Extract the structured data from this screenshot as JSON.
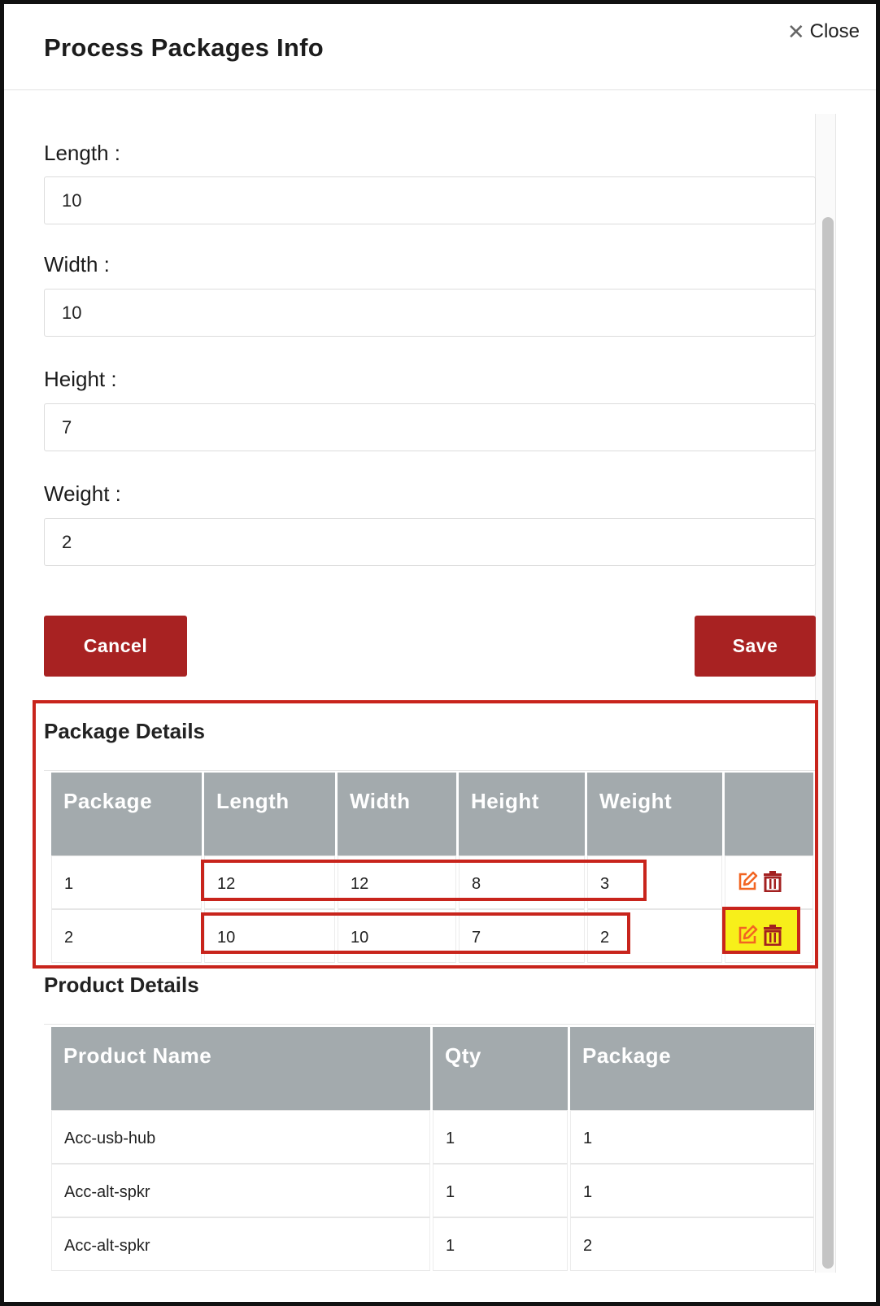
{
  "modal": {
    "title": "Process Packages Info",
    "close_label": "Close"
  },
  "form": {
    "length_label": "Length :",
    "length_value": "10",
    "width_label": "Width :",
    "width_value": "10",
    "height_label": "Height :",
    "height_value": "7",
    "weight_label": "Weight :",
    "weight_value": "2",
    "cancel_label": "Cancel",
    "save_label": "Save"
  },
  "package_details": {
    "title": "Package Details",
    "headers": [
      "Package",
      "Length",
      "Width",
      "Height",
      "Weight",
      ""
    ],
    "rows": [
      {
        "package": "1",
        "length": "12",
        "width": "12",
        "height": "8",
        "weight": "3"
      },
      {
        "package": "2",
        "length": "10",
        "width": "10",
        "height": "7",
        "weight": "2"
      }
    ]
  },
  "product_details": {
    "title": "Product Details",
    "headers": [
      "Product Name",
      "Qty",
      "Package"
    ],
    "rows": [
      {
        "name": "Acc-usb-hub",
        "qty": "1",
        "package": "1"
      },
      {
        "name": "Acc-alt-spkr",
        "qty": "1",
        "package": "1"
      },
      {
        "name": "Acc-alt-spkr",
        "qty": "1",
        "package": "2"
      }
    ]
  },
  "colors": {
    "primary_button": "#a82222",
    "table_header": "#a3aaad",
    "annotation_red": "#c8241c",
    "annotation_yellow": "#f7ef1a",
    "edit_icon": "#f26522",
    "delete_icon": "#a32020"
  },
  "icons": {
    "close": "close-icon",
    "edit": "edit-icon",
    "delete": "trash-icon"
  }
}
